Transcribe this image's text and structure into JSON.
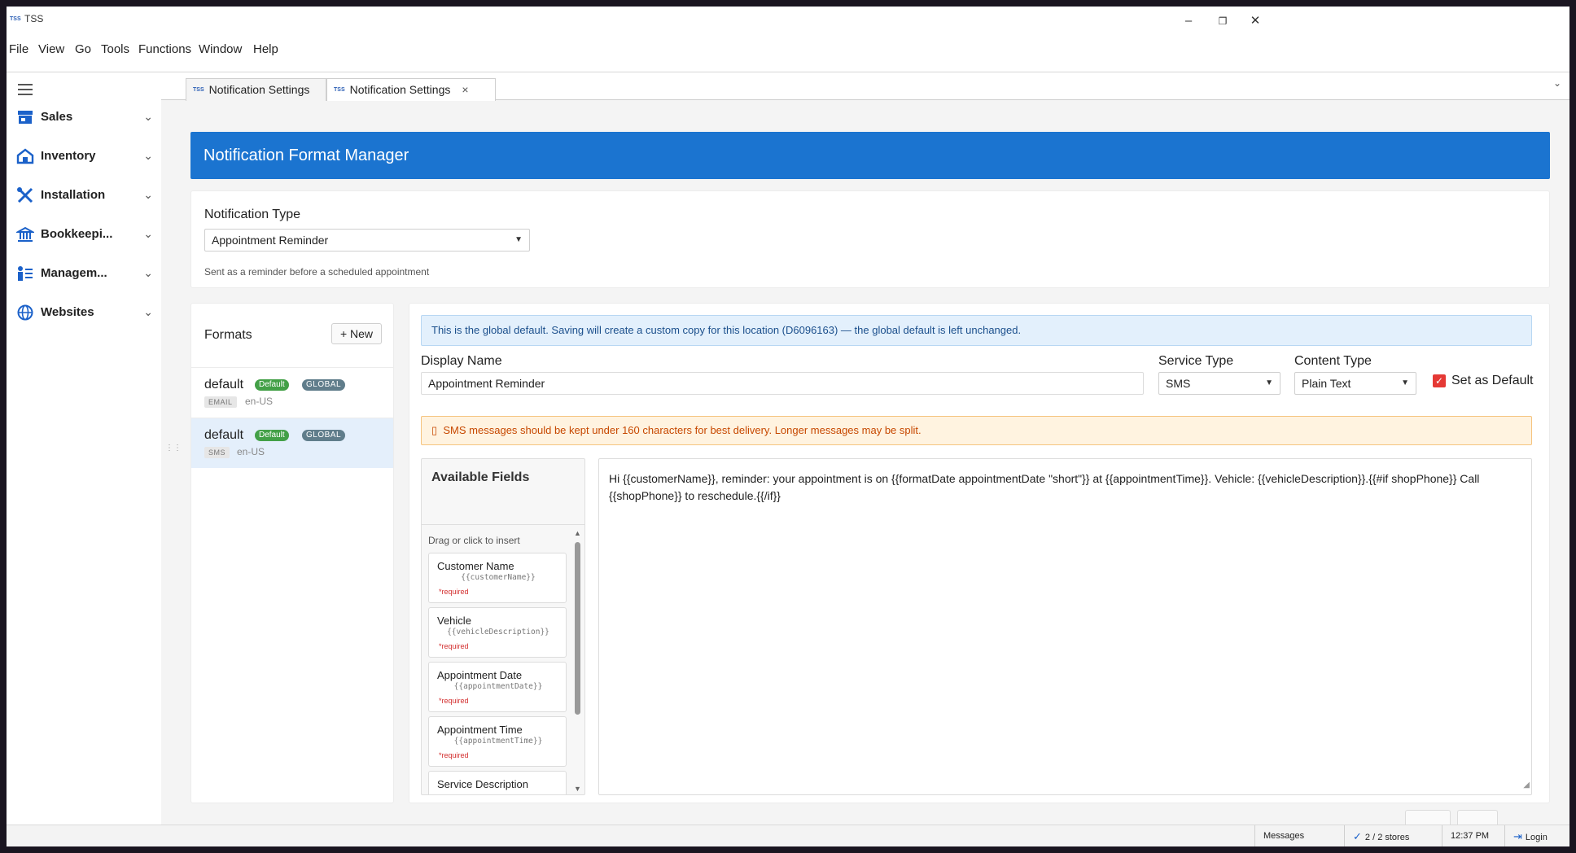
{
  "window": {
    "logo": "TSS",
    "title": "TSS",
    "controls": {
      "minimize": "–",
      "restore": "❐",
      "close": "✕"
    }
  },
  "menu": [
    "File",
    "View",
    "Go",
    "Tools",
    "Functions",
    "Window",
    "Help"
  ],
  "sidebar": {
    "items": [
      {
        "label": "Sales",
        "icon": "store-icon"
      },
      {
        "label": "Inventory",
        "icon": "warehouse-icon"
      },
      {
        "label": "Installation",
        "icon": "tools-icon"
      },
      {
        "label": "Bookkeepi...",
        "icon": "bank-icon"
      },
      {
        "label": "Managem...",
        "icon": "manager-icon"
      },
      {
        "label": "Websites",
        "icon": "globe-icon"
      }
    ]
  },
  "tabs": [
    {
      "logo": "TSS",
      "label": "Notification Settings",
      "active": false
    },
    {
      "logo": "TSS",
      "label": "Notification Settings",
      "active": true,
      "close": "×"
    }
  ],
  "header": {
    "title": "Notification Format Manager",
    "color": "#1b74d0"
  },
  "notification_type": {
    "label": "Notification Type",
    "value": "Appointment Reminder",
    "hint": "Sent as a reminder before a scheduled appointment"
  },
  "formats": {
    "title": "Formats",
    "new_label": "+ New",
    "items": [
      {
        "name": "default",
        "badge_default": "Default",
        "badge_global": "GLOBAL",
        "service": "EMAIL",
        "locale": "en-US",
        "selected": false
      },
      {
        "name": "default",
        "badge_default": "Default",
        "badge_global": "GLOBAL",
        "service": "SMS",
        "locale": "en-US",
        "selected": true
      }
    ]
  },
  "editor": {
    "info_banner": "This is the global default. Saving will create a custom copy for this location (D6096163) — the global default is left unchanged.",
    "display_name_label": "Display Name",
    "display_name_value": "Appointment Reminder",
    "service_type_label": "Service Type",
    "service_type_value": "SMS",
    "content_type_label": "Content Type",
    "content_type_value": "Plain Text",
    "set_default_label": "Set as Default",
    "set_default_checked": true,
    "warning_icon": "▯",
    "warning": "SMS messages should be kept under 160 characters for best delivery. Longer messages may be split.",
    "available_fields": {
      "title": "Available Fields",
      "hint": "Drag or click to insert",
      "required_label": "*required",
      "fields": [
        {
          "name": "Customer Name",
          "token": "{{customerName}}",
          "required": true
        },
        {
          "name": "Vehicle",
          "token": "{{vehicleDescription}}",
          "required": true
        },
        {
          "name": "Appointment Date",
          "token": "{{appointmentDate}}",
          "required": true
        },
        {
          "name": "Appointment Time",
          "token": "{{appointmentTime}}",
          "required": true
        },
        {
          "name": "Service Description",
          "token": "",
          "required": false
        }
      ]
    },
    "template": "Hi {{customerName}}, reminder: your appointment is on {{formatDate appointmentDate \"short\"}} at {{appointmentTime}}. Vehicle: {{vehicleDescription}}.{{#if shopPhone}} Call {{shopPhone}} to reschedule.{{/if}}"
  },
  "statusbar": {
    "messages": "Messages",
    "stores": "2 / 2 stores",
    "time": "12:37 PM",
    "login": "Login"
  },
  "colors": {
    "accent": "#1b74d0",
    "nav_icon": "#1b61c9",
    "default_badge": "#43a047",
    "global_badge": "#607d8b",
    "warning_text": "#c74800"
  }
}
